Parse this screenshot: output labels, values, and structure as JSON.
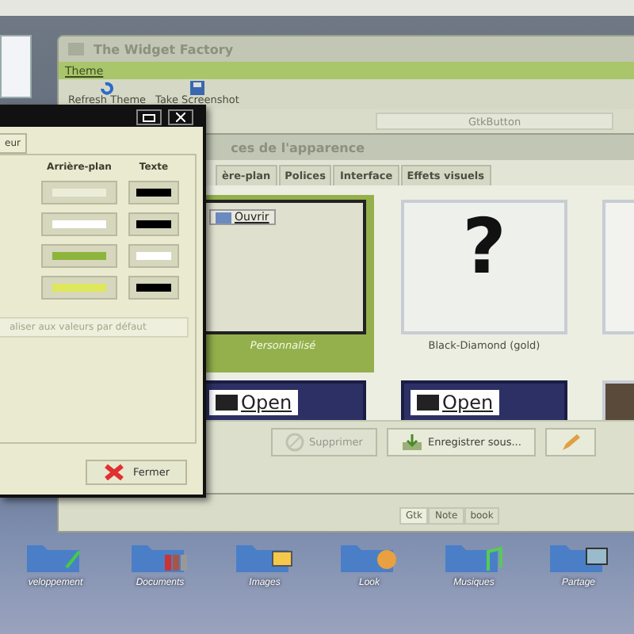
{
  "widget_factory": {
    "title": "The Widget Factory",
    "menu": [
      "Theme"
    ],
    "toolbar": [
      {
        "label": "Refresh Theme",
        "kind": "refresh"
      },
      {
        "label": "Take Screenshot",
        "kind": "save"
      }
    ],
    "button": "GtkButton",
    "notebook_tabs": [
      {
        "label": "Gtk",
        "selected": true
      },
      {
        "label": "Note",
        "selected": false
      },
      {
        "label": "book",
        "selected": false
      }
    ]
  },
  "appearance": {
    "title": "ces de l'apparence",
    "tabs": [
      {
        "label": "ère-plan",
        "selected": false
      },
      {
        "label": "Polices",
        "selected": false
      },
      {
        "label": "Interface",
        "selected": false
      },
      {
        "label": "Effets visuels",
        "selected": false
      }
    ],
    "themes": [
      {
        "name": "Personnalisé",
        "kind": "light",
        "button": "Ouvrir",
        "selected": true
      },
      {
        "name": "Black-Diamond (gold)",
        "kind": "missing",
        "symbol": "?",
        "selected": false
      },
      {
        "kind": "partial",
        "selected": false
      },
      {
        "kind": "dark",
        "button": "Open",
        "selected": false
      },
      {
        "kind": "dark",
        "button": "Open",
        "selected": false
      },
      {
        "kind": "brown",
        "selected": false
      }
    ],
    "actions": [
      {
        "label": "Supprimer",
        "kind": "delete",
        "disabled": true
      },
      {
        "label": "Enregistrer sous...",
        "kind": "save",
        "disabled": false
      },
      {
        "kind": "edit",
        "disabled": false
      }
    ]
  },
  "color_dialog": {
    "tab": "eur",
    "columns": [
      "Arrière-plan",
      "Texte"
    ],
    "rows": [
      {
        "background": {
          "color": "#ecedd9"
        },
        "text": {
          "color": "#000000"
        }
      },
      {
        "background": {
          "color": "#ffffff"
        },
        "text": {
          "color": "#000000"
        }
      },
      {
        "background": {
          "color": "#8db43c"
        },
        "text": {
          "color": "#ffffff"
        }
      },
      {
        "background": {
          "color": "#dfe85c"
        },
        "text": {
          "color": "#000000"
        }
      }
    ],
    "reset_button": "aliser aux valeurs par défaut",
    "close_button": "Fermer"
  },
  "desktop_icons": [
    {
      "label": "veloppement",
      "kind": "tools"
    },
    {
      "label": "Documents",
      "kind": "binders"
    },
    {
      "label": "Images",
      "kind": "photo"
    },
    {
      "label": "Look",
      "kind": "palette"
    },
    {
      "label": "Musiques",
      "kind": "music"
    },
    {
      "label": "Partage",
      "kind": "screen"
    }
  ]
}
